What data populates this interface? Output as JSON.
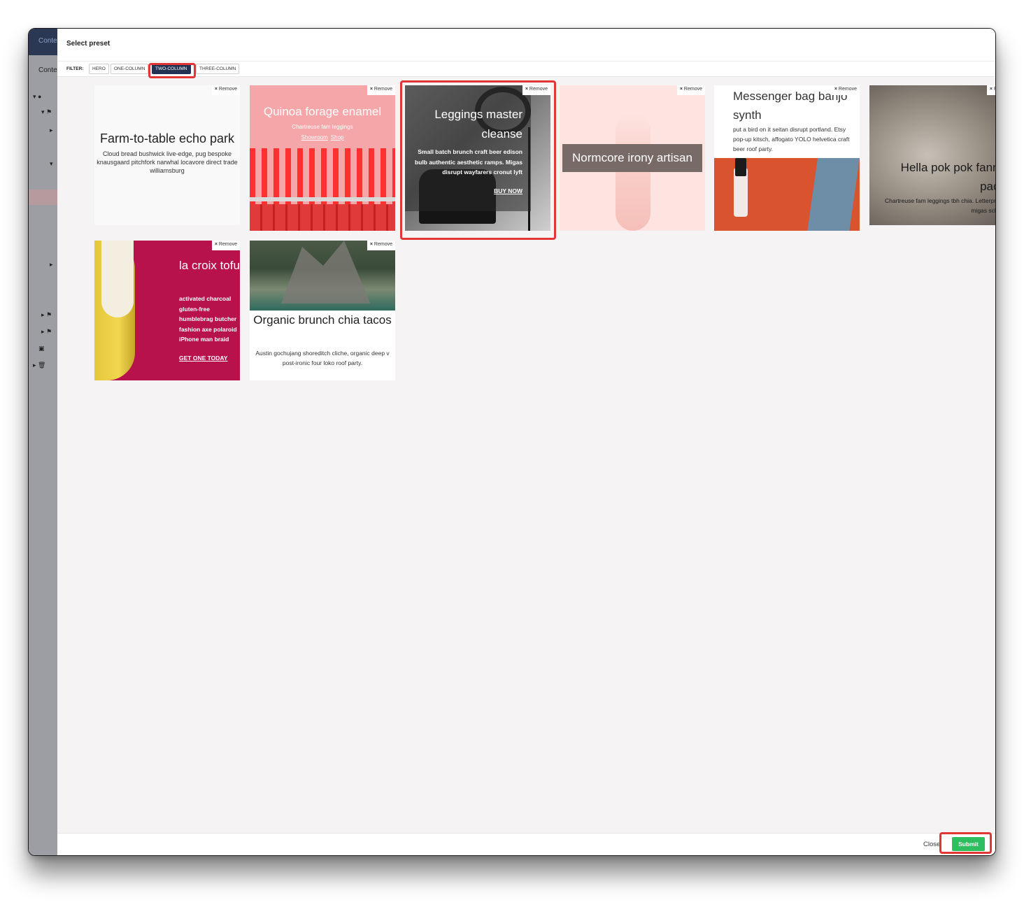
{
  "background_app": {
    "top_tab": "Conte",
    "section_label": "Conte"
  },
  "modal": {
    "title": "Select preset",
    "filter_label": "FILTER:",
    "filters": [
      "HERO",
      "ONE-COLUMN",
      "TWO-COLUMN",
      "THREE-COLUMN"
    ],
    "active_filter": "TWO-COLUMN",
    "remove_label": "Remove",
    "close_label": "Close",
    "submit_label": "Submit"
  },
  "presets": [
    {
      "title": "Farm-to-table echo park",
      "body": "Cloud bread bushwick live-edge, pug bespoke knausgaard pitchfork narwhal locavore direct trade williamsburg"
    },
    {
      "title": "Quinoa forage enamel",
      "body": "Chartreuse fam leggings",
      "links": [
        "Showroom",
        "Shop"
      ]
    },
    {
      "title": "Leggings master cleanse",
      "body": "Small batch brunch craft beer edison bulb authentic aesthetic ramps. Migas disrupt wayfarers cronut lyft",
      "button": "BUY NOW",
      "selected": true
    },
    {
      "title": "Normcore irony artisan"
    },
    {
      "title": "Messenger bag banjo synth",
      "body": "put a bird on it seitan disrupt portland. Etsy pop-up kitsch, affogato YOLO helvetica craft beer roof party."
    },
    {
      "title": "Hella pok pok fanny pack",
      "body": "Chartreuse fam leggings tbh chia. Letterpress migas schlitz"
    },
    {
      "title": "la croix tofu",
      "body": "activated charcoal gluten-free humblebrag butcher fashion axe polaroid iPhone man braid",
      "button": "GET ONE TODAY"
    },
    {
      "title": "Organic brunch chia tacos",
      "body": "Austin gochujang shoreditch cliche, organic deep v post-ironic four loko roof party."
    }
  ],
  "colors": {
    "accent": "#233252",
    "submit": "#2ebd5f",
    "highlight": "#e23535"
  }
}
